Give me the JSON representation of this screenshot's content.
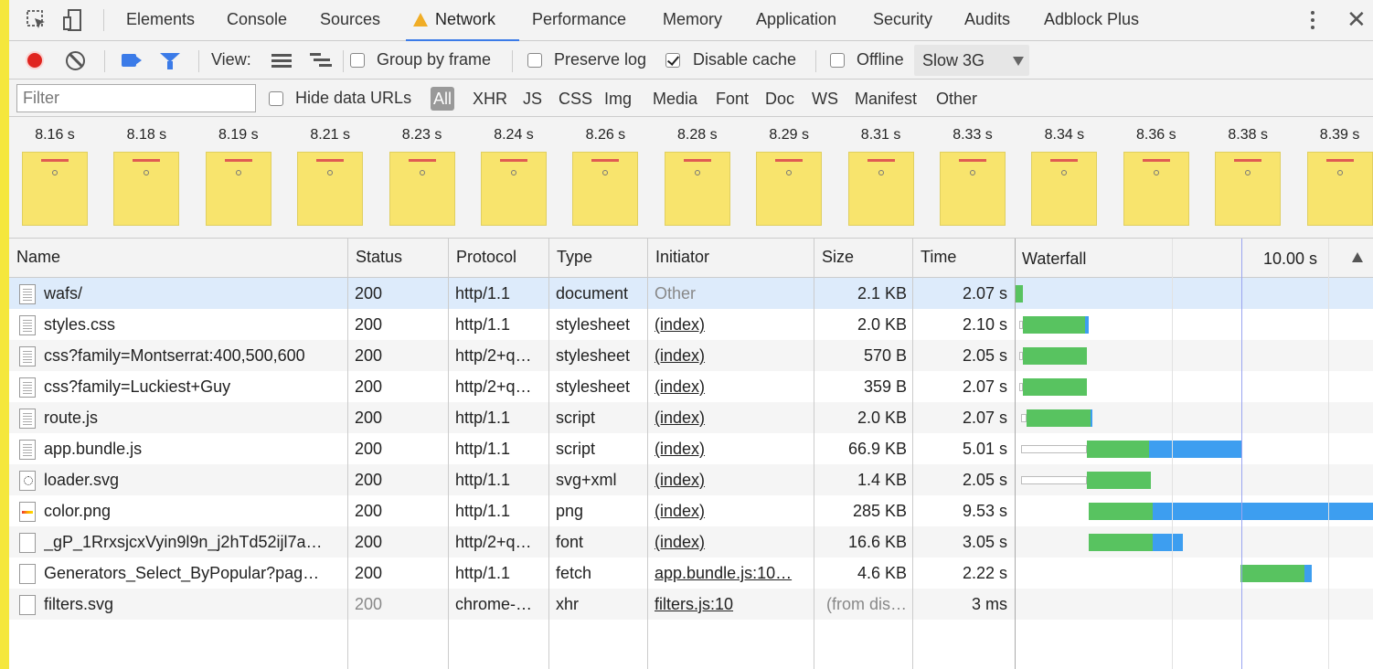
{
  "tabs": [
    {
      "label": "Elements",
      "active": false
    },
    {
      "label": "Console",
      "active": false
    },
    {
      "label": "Sources",
      "active": false
    },
    {
      "label": "Network",
      "active": true,
      "warning": true
    },
    {
      "label": "Performance",
      "active": false
    },
    {
      "label": "Memory",
      "active": false
    },
    {
      "label": "Application",
      "active": false
    },
    {
      "label": "Security",
      "active": false
    },
    {
      "label": "Audits",
      "active": false
    },
    {
      "label": "Adblock Plus",
      "active": false
    }
  ],
  "toolbar": {
    "view_label": "View:",
    "group_by_frame": {
      "label": "Group by frame",
      "checked": false
    },
    "preserve_log": {
      "label": "Preserve log",
      "checked": false
    },
    "disable_cache": {
      "label": "Disable cache",
      "checked": true
    },
    "offline": {
      "label": "Offline",
      "checked": false
    },
    "throttling": "Slow 3G"
  },
  "filter": {
    "placeholder": "Filter",
    "hide_data_urls": {
      "label": "Hide data URLs",
      "checked": false
    },
    "types": [
      "All",
      "XHR",
      "JS",
      "CSS",
      "Img",
      "Media",
      "Font",
      "Doc",
      "WS",
      "Manifest",
      "Other"
    ],
    "active_type": "All"
  },
  "filmstrip": [
    "8.16 s",
    "8.18 s",
    "8.19 s",
    "8.21 s",
    "8.23 s",
    "8.24 s",
    "8.26 s",
    "8.28 s",
    "8.29 s",
    "8.31 s",
    "8.33 s",
    "8.34 s",
    "8.36 s",
    "8.38 s",
    "8.39 s"
  ],
  "columns": {
    "name": "Name",
    "status": "Status",
    "protocol": "Protocol",
    "type": "Type",
    "initiator": "Initiator",
    "size": "Size",
    "time": "Time",
    "waterfall": "Waterfall",
    "waterfall_scale": "10.00 s"
  },
  "rows": [
    {
      "name": "wafs/",
      "status": "200",
      "protocol": "http/1.1",
      "type": "document",
      "initiator": "Other",
      "size": "2.1 KB",
      "time": "2.07 s"
    },
    {
      "name": "styles.css",
      "status": "200",
      "protocol": "http/1.1",
      "type": "stylesheet",
      "initiator": "(index)",
      "size": "2.0 KB",
      "time": "2.10 s"
    },
    {
      "name": "css?family=Montserrat:400,500,600",
      "status": "200",
      "protocol": "http/2+q…",
      "type": "stylesheet",
      "initiator": "(index)",
      "size": "570 B",
      "time": "2.05 s"
    },
    {
      "name": "css?family=Luckiest+Guy",
      "status": "200",
      "protocol": "http/2+q…",
      "type": "stylesheet",
      "initiator": "(index)",
      "size": "359 B",
      "time": "2.07 s"
    },
    {
      "name": "route.js",
      "status": "200",
      "protocol": "http/1.1",
      "type": "script",
      "initiator": "(index)",
      "size": "2.0 KB",
      "time": "2.07 s"
    },
    {
      "name": "app.bundle.js",
      "status": "200",
      "protocol": "http/1.1",
      "type": "script",
      "initiator": "(index)",
      "size": "66.9 KB",
      "time": "5.01 s"
    },
    {
      "name": "loader.svg",
      "status": "200",
      "protocol": "http/1.1",
      "type": "svg+xml",
      "initiator": "(index)",
      "size": "1.4 KB",
      "time": "2.05 s"
    },
    {
      "name": "color.png",
      "status": "200",
      "protocol": "http/1.1",
      "type": "png",
      "initiator": "(index)",
      "size": "285 KB",
      "time": "9.53 s"
    },
    {
      "name": "_gP_1RrxsjcxVyin9l9n_j2hTd52ijl7a…",
      "status": "200",
      "protocol": "http/2+q…",
      "type": "font",
      "initiator": "(index)",
      "size": "16.6 KB",
      "time": "3.05 s"
    },
    {
      "name": "Generators_Select_ByPopular?pag…",
      "status": "200",
      "protocol": "http/1.1",
      "type": "fetch",
      "initiator": "app.bundle.js:10…",
      "size": "4.6 KB",
      "time": "2.22 s"
    },
    {
      "name": "filters.svg",
      "status": "200",
      "protocol": "chrome-…",
      "type": "xhr",
      "initiator": "filters.js:10",
      "size": "(from dis…",
      "time": "3 ms"
    }
  ]
}
